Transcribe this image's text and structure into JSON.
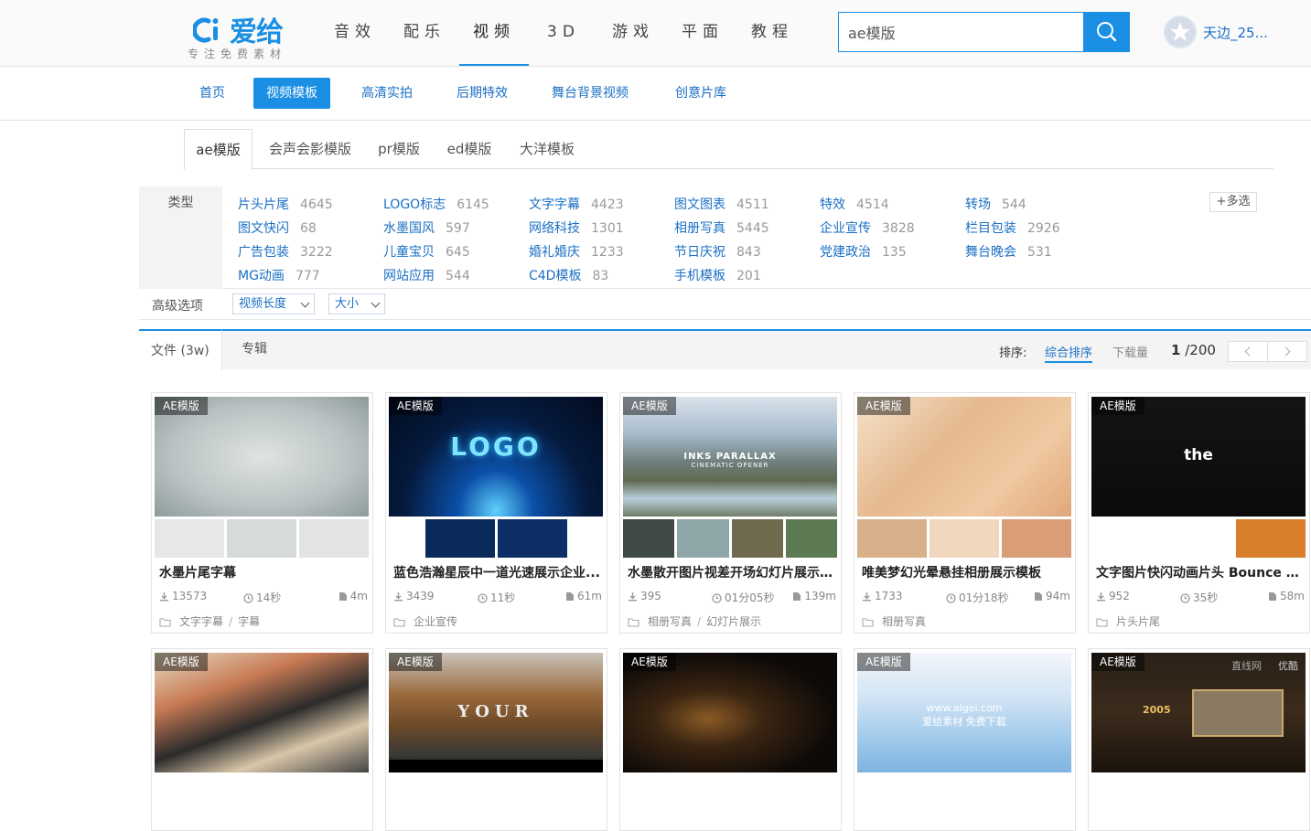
{
  "logo": {
    "name": "爱给",
    "tagline": "专注免费素材"
  },
  "main_nav": [
    "音效",
    "配乐",
    "视频",
    "3D",
    "游戏",
    "平面",
    "教程"
  ],
  "search": {
    "value": "ae模版"
  },
  "user": {
    "name": "天边_25..."
  },
  "sub_nav": [
    "首页",
    "视频模板",
    "高清实拍",
    "后期特效",
    "舞台背景视频",
    "创意片库"
  ],
  "category_tabs": [
    "ae模版",
    "会声会影模版",
    "pr模版",
    "ed模版",
    "大洋模板"
  ],
  "filter": {
    "label": "类型",
    "multi_label": "+多选",
    "items": [
      {
        "name": "片头片尾",
        "count": "4645"
      },
      {
        "name": "LOGO标志",
        "count": "6145"
      },
      {
        "name": "文字字幕",
        "count": "4423"
      },
      {
        "name": "图文图表",
        "count": "4511"
      },
      {
        "name": "特效",
        "count": "4514"
      },
      {
        "name": "转场",
        "count": "544"
      },
      {
        "name": "图文快闪",
        "count": "68"
      },
      {
        "name": "水墨国风",
        "count": "597"
      },
      {
        "name": "网络科技",
        "count": "1301"
      },
      {
        "name": "相册写真",
        "count": "5445"
      },
      {
        "name": "企业宣传",
        "count": "3828"
      },
      {
        "name": "栏目包装",
        "count": "2926"
      },
      {
        "name": "广告包装",
        "count": "3222"
      },
      {
        "name": "儿童宝贝",
        "count": "645"
      },
      {
        "name": "婚礼婚庆",
        "count": "1233"
      },
      {
        "name": "节日庆祝",
        "count": "843"
      },
      {
        "name": "党建政治",
        "count": "135"
      },
      {
        "name": "舞台晚会",
        "count": "531"
      },
      {
        "name": "MG动画",
        "count": "777"
      },
      {
        "name": "网站应用",
        "count": "544"
      },
      {
        "name": "C4D模板",
        "count": "83"
      },
      {
        "name": "手机模板",
        "count": "201"
      }
    ]
  },
  "advanced": {
    "label": "高级选项",
    "video_length": "视频长度",
    "size": "大小"
  },
  "results": {
    "tab_files": "文件 (3w)",
    "tab_albums": "专辑",
    "sort_label": "排序:",
    "sort_active": "综合排序",
    "sort_downloads": "下载量",
    "page_current": "1",
    "page_total": "/200"
  },
  "cards": [
    {
      "badge": "AE模版",
      "title": "水墨片尾字幕",
      "downloads": "13573",
      "duration": "14秒",
      "size": "4m",
      "tags": [
        "文字字幕",
        "字幕"
      ]
    },
    {
      "badge": "AE模版",
      "title": "蓝色浩瀚星辰中一道光速展示企业...",
      "downloads": "3439",
      "duration": "11秒",
      "size": "61m",
      "tags": [
        "企业宣传"
      ]
    },
    {
      "badge": "AE模版",
      "title": "水墨散开图片视差开场幻灯片展示 ...",
      "downloads": "395",
      "duration": "01分05秒",
      "size": "139m",
      "tags": [
        "相册写真",
        "幻灯片展示"
      ]
    },
    {
      "badge": "AE模版",
      "title": "唯美梦幻光晕悬挂相册展示模板",
      "downloads": "1733",
      "duration": "01分18秒",
      "size": "94m",
      "tags": [
        "相册写真"
      ]
    },
    {
      "badge": "AE模版",
      "title": "文字图片快闪动画片头 Bounce D...",
      "downloads": "952",
      "duration": "35秒",
      "size": "58m",
      "tags": [
        "片头片尾"
      ]
    },
    {
      "badge": "AE模版"
    },
    {
      "badge": "AE模版"
    },
    {
      "badge": "AE模版"
    },
    {
      "badge": "AE模版"
    },
    {
      "badge": "AE模版"
    }
  ],
  "thumb_text": {
    "logo": "LOGO",
    "parallax": "INKS PARALLAX",
    "parallax_sub": "CINEMATIC OPENER",
    "the": "the",
    "your": "YOUR",
    "watermark": "www.aigei.com",
    "watermark2": "爱给素材 免费下载",
    "year": "2005",
    "zhixian": "直线网",
    "youku": "优酷"
  },
  "colors": {
    "accent": "#1a8fe3",
    "link": "#1a6fc4"
  }
}
